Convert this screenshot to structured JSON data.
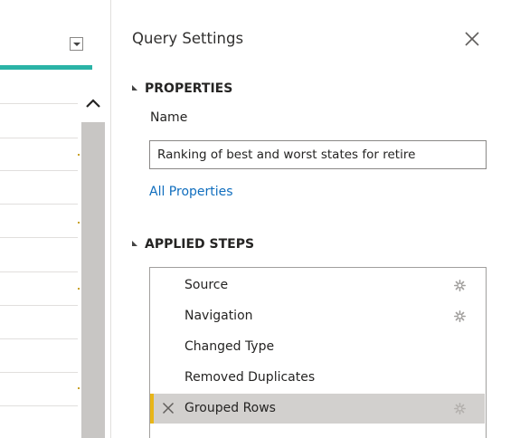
{
  "query_settings": {
    "title": "Query Settings",
    "close_icon": "close-icon"
  },
  "properties": {
    "heading": "PROPERTIES",
    "name_label": "Name",
    "name_value": "Ranking of best and worst states for retire",
    "all_properties_link": "All Properties"
  },
  "applied_steps": {
    "heading": "APPLIED STEPS",
    "steps": [
      {
        "label": "Source",
        "has_gear": true,
        "selected": false
      },
      {
        "label": "Navigation",
        "has_gear": true,
        "selected": false
      },
      {
        "label": "Changed Type",
        "has_gear": false,
        "selected": false
      },
      {
        "label": "Removed Duplicates",
        "has_gear": false,
        "selected": false
      },
      {
        "label": "Grouped Rows",
        "has_gear": true,
        "selected": true
      }
    ]
  },
  "colors": {
    "column_accent": "#2ab3a6",
    "selected_step_accent": "#e8b618",
    "link": "#106ebe"
  }
}
